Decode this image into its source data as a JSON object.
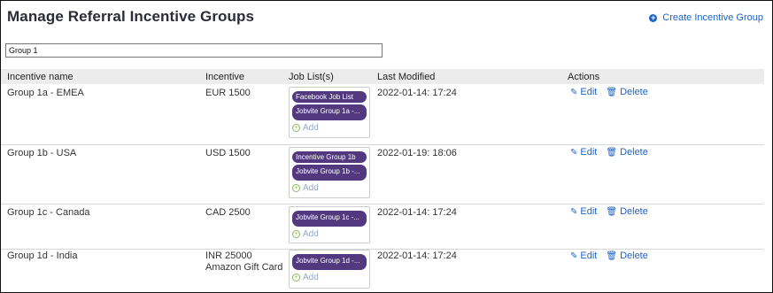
{
  "header": {
    "title": "Manage Referral Incentive Groups",
    "create_label": "Create Incentive Group"
  },
  "search": {
    "value": "Group 1"
  },
  "columns": {
    "name": "Incentive name",
    "incentive": "Incentive",
    "job_lists": "Job List(s)",
    "last_modified": "Last Modified",
    "actions": "Actions"
  },
  "actions": {
    "edit_label": "Edit",
    "delete_label": "Delete",
    "add_label": "Add"
  },
  "rows": [
    {
      "name": "Group 1a - EMEA",
      "incentive": [
        "EUR 1500"
      ],
      "jobs": [
        "Facebook Job List",
        "Jobvite Group 1a -..."
      ],
      "modified": "2022-01-14: 17:24"
    },
    {
      "name": "Group 1b - USA",
      "incentive": [
        "USD 1500"
      ],
      "jobs": [
        "Incentive Group 1b",
        "Jobvite Group 1b -..."
      ],
      "modified": "2022-01-19: 18:06"
    },
    {
      "name": "Group 1c - Canada",
      "incentive": [
        "CAD 2500"
      ],
      "jobs": [
        "Jobvite Group 1c -..."
      ],
      "modified": "2022-01-14: 17:24"
    },
    {
      "name": "Group 1d - India",
      "incentive": [
        "INR 25000",
        "Amazon Gift Card"
      ],
      "jobs": [
        "Jobvite Group 1d -..."
      ],
      "modified": "2022-01-14: 17:24"
    }
  ],
  "colors": {
    "accent": "#1f63c6",
    "pill": "#52397f",
    "add": "#88b85c"
  }
}
